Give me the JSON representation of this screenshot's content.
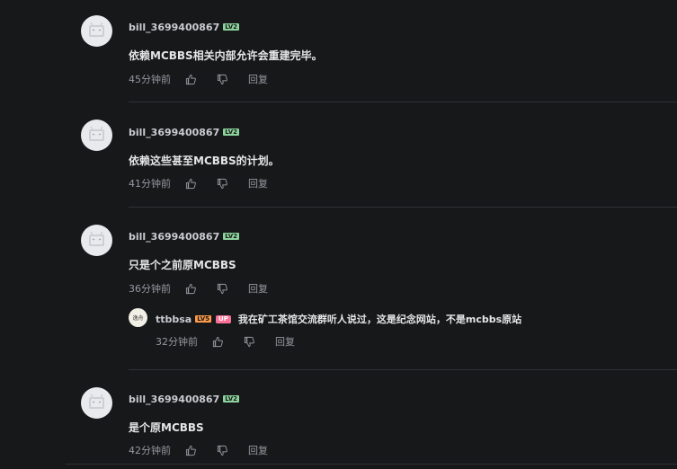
{
  "comments": [
    {
      "user": "bill_3699400867",
      "level": "LV2",
      "text": "依赖MCBBS相关内部允许会重建完毕。",
      "time": "45分钟前",
      "reply_label": "回复"
    },
    {
      "user": "bill_3699400867",
      "level": "LV2",
      "text": "依赖这些甚至MCBBS的计划。",
      "time": "41分钟前",
      "reply_label": "回复"
    },
    {
      "user": "bill_3699400867",
      "level": "LV2",
      "text": "只是个之前原MCBBS",
      "time": "36分钟前",
      "reply_label": "回复",
      "sub_reply": {
        "avatar_text": "逸舟",
        "user": "ttbbsa",
        "level": "LV5",
        "up_badge": "UP",
        "text": "我在矿工茶馆交流群听人说过，这是纪念网站，不是mcbbs原站",
        "time": "32分钟前",
        "reply_label": "回复"
      }
    },
    {
      "user": "bill_3699400867",
      "level": "LV2",
      "text": "是个原MCBBS",
      "time": "42分钟前",
      "reply_label": "回复"
    }
  ],
  "colors": {
    "background": "#17181a",
    "level_badge": "#8bd29b",
    "level5_badge": "#ff9a4a",
    "up_badge": "#fb7299"
  },
  "icons": [
    "default-avatar-icon",
    "thumbs-up-icon",
    "thumbs-down-icon"
  ]
}
